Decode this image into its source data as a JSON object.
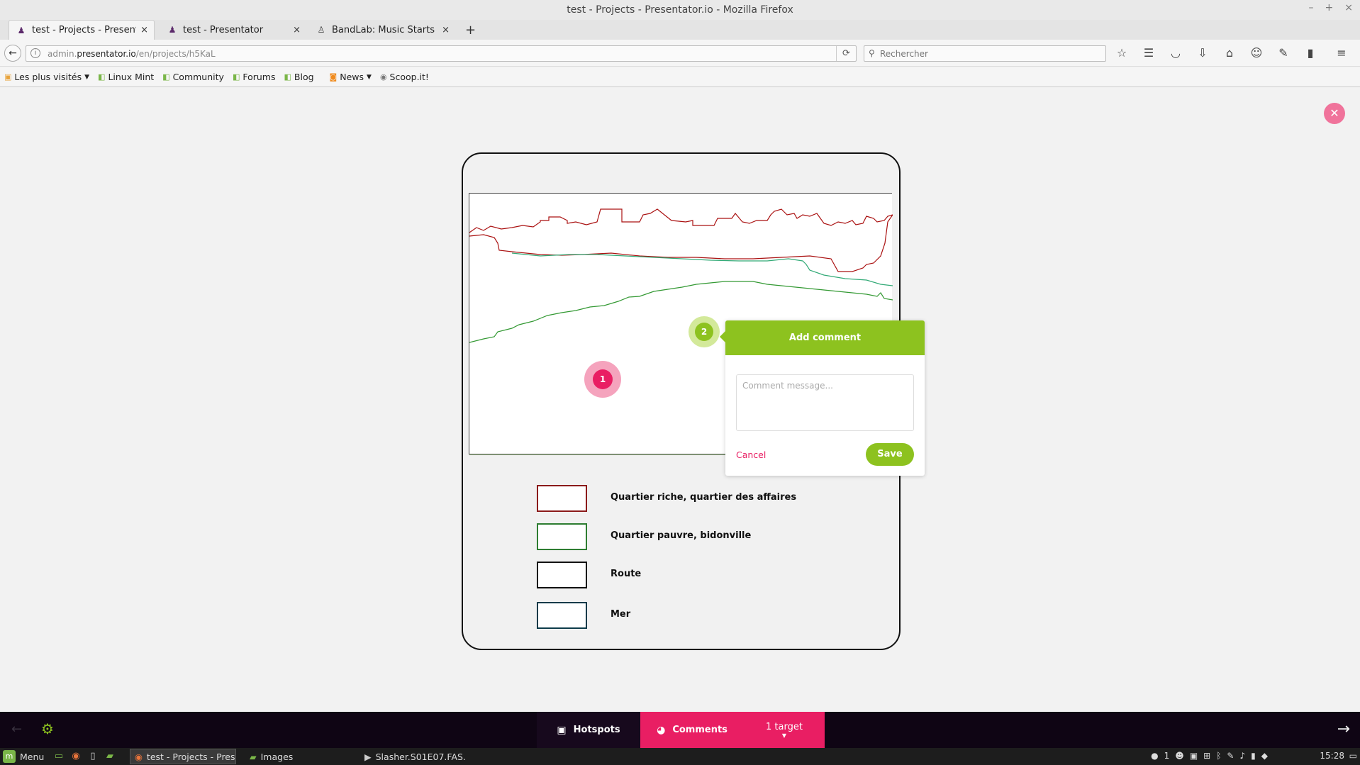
{
  "window": {
    "title": "test - Projects - Presentator.io - Mozilla Firefox",
    "min": "–",
    "max": "+",
    "close": "×"
  },
  "tabs": [
    {
      "label": "test - Projects - Presentat…",
      "close": "×"
    },
    {
      "label": "test - Presentator",
      "close": "×"
    },
    {
      "label": "BandLab: Music Starts H…",
      "close": "×"
    }
  ],
  "newtab": "+",
  "nav": {
    "url_prefix": "admin.",
    "url_domain": "presentator.io",
    "url_path": "/en/projects/h5KaL",
    "search_placeholder": "Rechercher"
  },
  "bookmarks": [
    {
      "label": "Les plus visités",
      "icon": "folder-icon"
    },
    {
      "label": "Linux Mint",
      "icon": "mint-icon"
    },
    {
      "label": "Community",
      "icon": "mint-icon"
    },
    {
      "label": "Forums",
      "icon": "mint-icon"
    },
    {
      "label": "Blog",
      "icon": "mint-icon"
    },
    {
      "label": "News",
      "icon": "rss-icon"
    },
    {
      "label": "Scoop.it!",
      "icon": "scoopit-icon"
    }
  ],
  "legend": [
    {
      "label": "Quartier riche, quartier des affaires",
      "color": "#8b1a1a"
    },
    {
      "label": "Quartier pauvre, bidonville",
      "color": "#2e7d32"
    },
    {
      "label": "Route",
      "color": "#111111"
    },
    {
      "label": "Mer",
      "color": "#0d3b4a"
    }
  ],
  "pins": [
    {
      "number": "1",
      "color": "#e91e63"
    },
    {
      "number": "2",
      "color": "#8dc21f"
    }
  ],
  "comment_popup": {
    "title": "Add comment",
    "placeholder": "Comment message...",
    "cancel": "Cancel",
    "save": "Save"
  },
  "appbar": {
    "hotspots": "Hotspots",
    "comments": "Comments",
    "target": "1 target"
  },
  "taskbar": {
    "menu": "Menu",
    "windows": [
      {
        "label": "test - Projects - Pres..."
      },
      {
        "label": "Images"
      },
      {
        "label": "Slasher.S01E07.FAS..."
      }
    ],
    "tray_count": "1",
    "clock": "15:28"
  },
  "colors": {
    "accent_green": "#8dc21f",
    "accent_pink": "#e91e63",
    "appbar_bg": "#0f0514"
  }
}
